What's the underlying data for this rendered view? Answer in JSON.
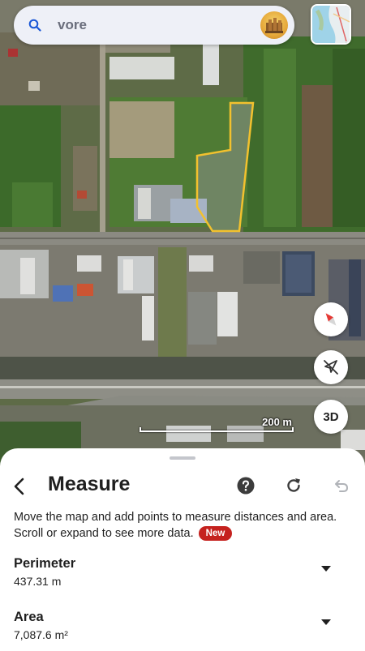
{
  "search": {
    "query": "vore",
    "icon": "search-icon"
  },
  "map": {
    "scale_label": "200 m",
    "three_d_label": "3D",
    "outline_color": "#f2c12e"
  },
  "sheet": {
    "title": "Measure",
    "description": "Move the map and add points to measure distances and area. Scroll or expand to see more data.",
    "badge": "New",
    "badge_color": "#c5221f",
    "perimeter": {
      "label": "Perimeter",
      "value": "437.31 m"
    },
    "area": {
      "label": "Area",
      "value": "7,087.6 m²"
    }
  }
}
